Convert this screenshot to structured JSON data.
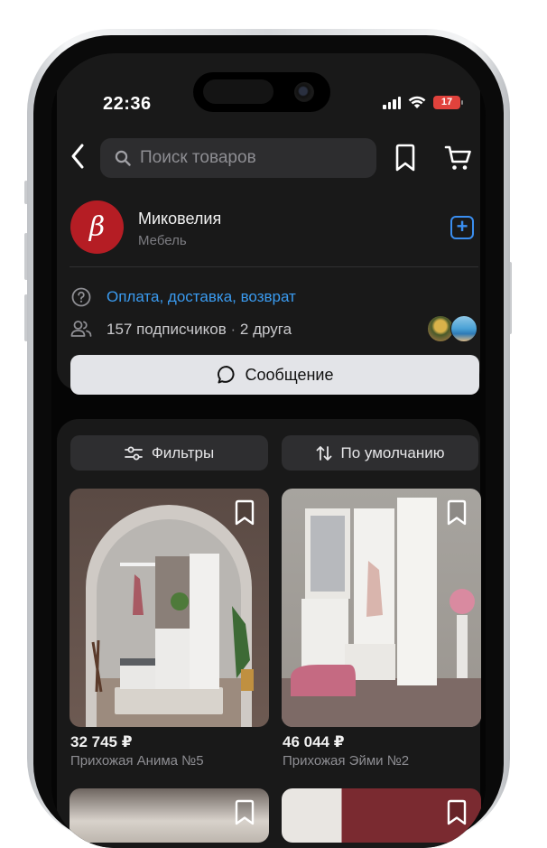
{
  "status_bar": {
    "time": "22:36",
    "battery": "17"
  },
  "header": {
    "search_placeholder": "Поиск товаров"
  },
  "shop": {
    "avatar_letter": "β",
    "name": "Миковелия",
    "category": "Мебель"
  },
  "info": {
    "link_text": "Оплата, доставка, возврат",
    "subscribers": "157 подписчиков",
    "separator": "·",
    "friends": "2 друга"
  },
  "message_button": "Сообщение",
  "filters": {
    "filter_label": "Фильтры",
    "sort_label": "По умолчанию"
  },
  "products": [
    {
      "price": "32 745 ₽",
      "name": "Прихожая Анима №5"
    },
    {
      "price": "46 044 ₽",
      "name": "Прихожая Эйми №2"
    }
  ],
  "colors": {
    "accent": "#3a8ef0",
    "link": "#3a9bf0",
    "avatar": "#b51d24",
    "battery": "#e0423c"
  }
}
